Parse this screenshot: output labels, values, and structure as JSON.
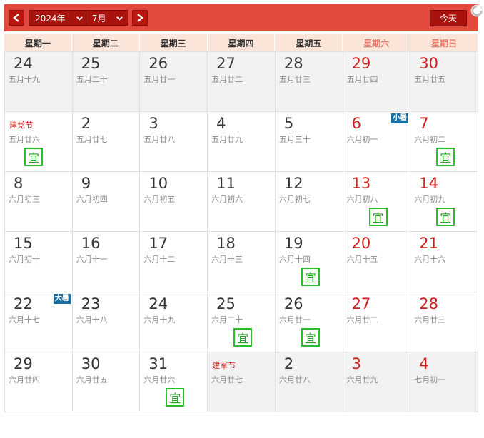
{
  "toolbar": {
    "year_label": "2024年",
    "month_label": "7月",
    "today_label": "今天"
  },
  "colors": {
    "header_red": "#e24a3e",
    "button_dark_red": "#a9130d",
    "weekend_red": "#cc1f1a",
    "yi_green": "#2bbd2b",
    "term_badge_blue": "#1a6fa0"
  },
  "weekdays": [
    "星期一",
    "星期二",
    "星期三",
    "星期四",
    "星期五",
    "星期六",
    "星期日"
  ],
  "days": [
    {
      "num": "24",
      "lunar": "五月十九",
      "other": true
    },
    {
      "num": "25",
      "lunar": "五月二十",
      "other": true
    },
    {
      "num": "26",
      "lunar": "五月廿一",
      "other": true
    },
    {
      "num": "27",
      "lunar": "五月廿二",
      "other": true
    },
    {
      "num": "28",
      "lunar": "五月廿三",
      "other": true
    },
    {
      "num": "29",
      "lunar": "五月廿四",
      "other": true
    },
    {
      "num": "30",
      "lunar": "五月廿五",
      "other": true
    },
    {
      "num": "",
      "lunar": "五月廿六",
      "festival": "建党节",
      "yi": "宜"
    },
    {
      "num": "2",
      "lunar": "五月廿七"
    },
    {
      "num": "3",
      "lunar": "五月廿八"
    },
    {
      "num": "4",
      "lunar": "五月廿九"
    },
    {
      "num": "5",
      "lunar": "五月三十"
    },
    {
      "num": "6",
      "lunar": "六月初一",
      "term": "小暑"
    },
    {
      "num": "7",
      "lunar": "六月初二",
      "yi": "宜"
    },
    {
      "num": "8",
      "lunar": "六月初三"
    },
    {
      "num": "9",
      "lunar": "六月初四"
    },
    {
      "num": "10",
      "lunar": "六月初五"
    },
    {
      "num": "11",
      "lunar": "六月初六"
    },
    {
      "num": "12",
      "lunar": "六月初七"
    },
    {
      "num": "13",
      "lunar": "六月初八",
      "yi": "宜"
    },
    {
      "num": "14",
      "lunar": "六月初九",
      "yi": "宜"
    },
    {
      "num": "15",
      "lunar": "六月初十"
    },
    {
      "num": "16",
      "lunar": "六月十一"
    },
    {
      "num": "17",
      "lunar": "六月十二"
    },
    {
      "num": "18",
      "lunar": "六月十三"
    },
    {
      "num": "19",
      "lunar": "六月十四",
      "yi": "宜"
    },
    {
      "num": "20",
      "lunar": "六月十五"
    },
    {
      "num": "21",
      "lunar": "六月十六"
    },
    {
      "num": "22",
      "lunar": "六月十七",
      "term": "大暑"
    },
    {
      "num": "23",
      "lunar": "六月十八"
    },
    {
      "num": "24",
      "lunar": "六月十九"
    },
    {
      "num": "25",
      "lunar": "六月二十",
      "yi": "宜"
    },
    {
      "num": "26",
      "lunar": "六月廿一",
      "yi": "宜"
    },
    {
      "num": "27",
      "lunar": "六月廿二"
    },
    {
      "num": "28",
      "lunar": "六月廿三"
    },
    {
      "num": "29",
      "lunar": "六月廿四"
    },
    {
      "num": "30",
      "lunar": "六月廿五"
    },
    {
      "num": "31",
      "lunar": "六月廿六",
      "yi": "宜"
    },
    {
      "num": "",
      "lunar": "六月廿七",
      "festival": "建军节",
      "other": true
    },
    {
      "num": "2",
      "lunar": "六月廿八",
      "other": true
    },
    {
      "num": "3",
      "lunar": "六月廿九",
      "other": true
    },
    {
      "num": "4",
      "lunar": "七月初一",
      "other": true
    }
  ]
}
